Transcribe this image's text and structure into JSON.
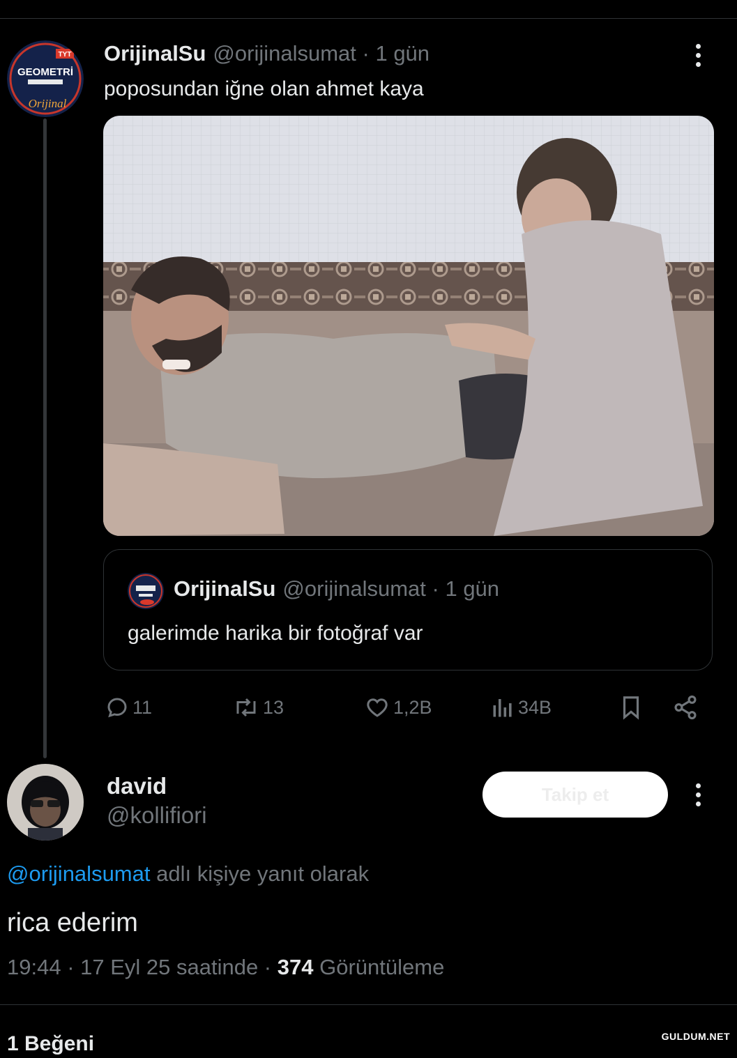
{
  "main_post": {
    "display_name": "OrijinalSu",
    "handle": "@orijinalsumat",
    "time": "· 1 gün",
    "text": "poposundan iğne olan ahmet kaya",
    "avatar_text": "GEOMETRİ",
    "avatar_badge": "TYT",
    "avatar_script": "Orijinal"
  },
  "quoted_post": {
    "display_name": "OrijinalSu",
    "handle": "@orijinalsumat",
    "time": "· 1 gün",
    "text": "galerimde harika bir fotoğraf var"
  },
  "actions": {
    "replies": "11",
    "reposts": "13",
    "likes": "1,2B",
    "views": "34B"
  },
  "reply": {
    "display_name": "david",
    "handle": "@kollifiori",
    "follow_label": "Takip et",
    "replying_to_handle": "@orijinalsumat",
    "replying_to_suffix": "adlı kişiye yanıt olarak",
    "text": "rica ederim",
    "timestamp": "19:44 · 17 Eyl 25 saatinde ·",
    "views_count": "374",
    "views_label": "Görüntüleme"
  },
  "footer": {
    "likes_partial": "1 Beğeni",
    "watermark": "GULDUM.NET"
  },
  "colors": {
    "background": "#000000",
    "text": "#e7e9ea",
    "muted": "#71767b",
    "link": "#1d9bf0",
    "border": "#2f3336"
  }
}
